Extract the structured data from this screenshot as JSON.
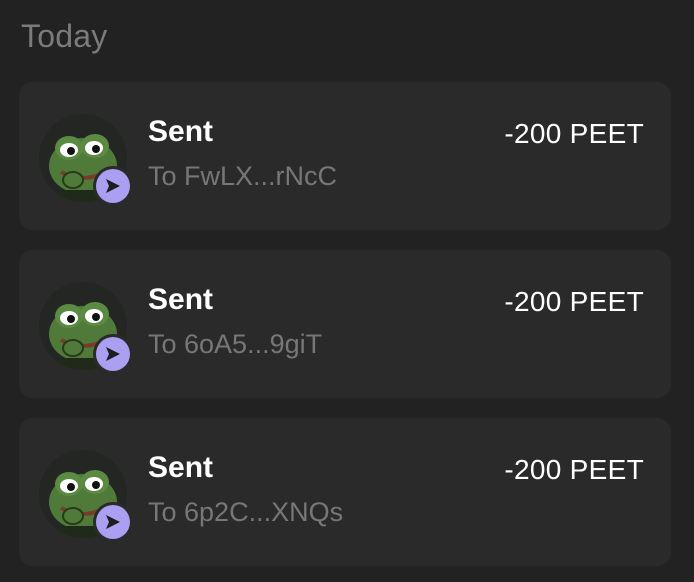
{
  "section": {
    "title": "Today"
  },
  "transactions": [
    {
      "title": "Sent",
      "subtitle": "To FwLX...rNcC",
      "amount": "-200 PEET",
      "avatar_icon": "pepe-token-icon",
      "badge_icon": "send-arrow-icon"
    },
    {
      "title": "Sent",
      "subtitle": "To 6oA5...9giT",
      "amount": "-200 PEET",
      "avatar_icon": "pepe-token-icon",
      "badge_icon": "send-arrow-icon"
    },
    {
      "title": "Sent",
      "subtitle": "To 6p2C...XNQs",
      "amount": "-200 PEET",
      "avatar_icon": "pepe-token-icon",
      "badge_icon": "send-arrow-icon"
    }
  ],
  "colors": {
    "background": "#222222",
    "card": "#2a2a2a",
    "badge": "#ab9ff2",
    "muted_text": "#777777"
  }
}
